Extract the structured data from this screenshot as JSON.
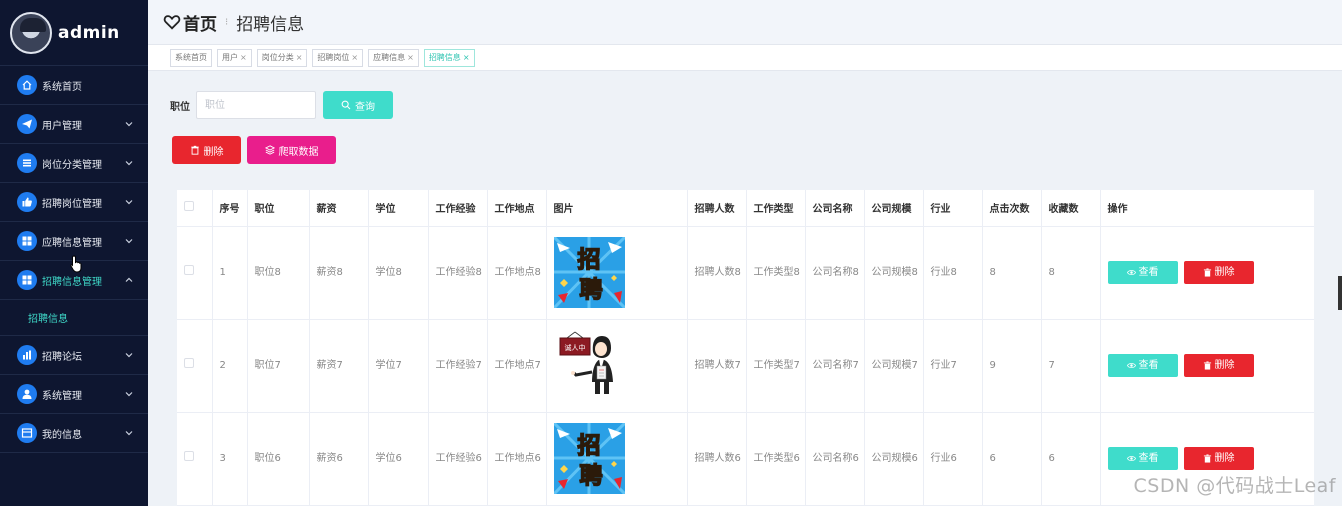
{
  "sidebar": {
    "username": "admin",
    "items": [
      {
        "label": "系统首页",
        "icon": "home-icon",
        "expandable": false
      },
      {
        "label": "用户管理",
        "icon": "paper-plane-icon",
        "expandable": true
      },
      {
        "label": "岗位分类管理",
        "icon": "list-icon",
        "expandable": true
      },
      {
        "label": "招聘岗位管理",
        "icon": "thumb-up-icon",
        "expandable": true
      },
      {
        "label": "应聘信息管理",
        "icon": "grid-icon",
        "expandable": true
      },
      {
        "label": "招聘信息管理",
        "icon": "grid-icon",
        "expandable": true,
        "active": true
      },
      {
        "label": "招聘论坛",
        "icon": "bar-chart-icon",
        "expandable": true
      },
      {
        "label": "系统管理",
        "icon": "user-icon",
        "expandable": true
      },
      {
        "label": "我的信息",
        "icon": "card-icon",
        "expandable": true
      }
    ],
    "submenu_label": "招聘信息"
  },
  "header": {
    "home": "首页",
    "current": "招聘信息"
  },
  "tags": [
    {
      "label": "系统首页",
      "closable": false
    },
    {
      "label": "用户",
      "closable": true
    },
    {
      "label": "岗位分类",
      "closable": true
    },
    {
      "label": "招聘岗位",
      "closable": true
    },
    {
      "label": "应聘信息",
      "closable": true
    },
    {
      "label": "招聘信息",
      "closable": true,
      "active": true
    }
  ],
  "search": {
    "label": "职位",
    "placeholder": "职位",
    "query_button": "查询"
  },
  "actions": {
    "delete_button": "删除",
    "crawl_button": "爬取数据"
  },
  "table": {
    "headers": [
      "序号",
      "职位",
      "薪资",
      "学位",
      "工作经验",
      "工作地点",
      "图片",
      "招聘人数",
      "工作类型",
      "公司名称",
      "公司规模",
      "行业",
      "点击次数",
      "收藏数",
      "操作"
    ],
    "rows": [
      {
        "idx": "1",
        "position": "职位8",
        "salary": "薪资8",
        "degree": "学位8",
        "exp": "工作经验8",
        "loc": "工作地点8",
        "pic": "zhaopin-poster",
        "count": "招聘人数8",
        "type": "工作类型8",
        "company": "公司名称8",
        "scale": "公司规模8",
        "industry": "行业8",
        "clicks": "8",
        "favs": "8"
      },
      {
        "idx": "2",
        "position": "职位7",
        "salary": "薪资7",
        "degree": "学位7",
        "exp": "工作经验7",
        "loc": "工作地点7",
        "pic": "recruiter-figure",
        "count": "招聘人数7",
        "type": "工作类型7",
        "company": "公司名称7",
        "scale": "公司规模7",
        "industry": "行业7",
        "clicks": "9",
        "favs": "7"
      },
      {
        "idx": "3",
        "position": "职位6",
        "salary": "薪资6",
        "degree": "学位6",
        "exp": "工作经验6",
        "loc": "工作地点6",
        "pic": "zhaopin-poster",
        "count": "招聘人数6",
        "type": "工作类型6",
        "company": "公司名称6",
        "scale": "公司规模6",
        "industry": "行业6",
        "clicks": "6",
        "favs": "6"
      }
    ],
    "view_label": "查看",
    "delete_label": "删除"
  },
  "poster_text": [
    "招",
    "聘"
  ],
  "sign_text": "诚人中",
  "watermark": "CSDN @代码战士Leaf",
  "colors": {
    "sidebar_bg": "#0e1630",
    "accent_teal": "#3fdccb",
    "danger_red": "#e8262e",
    "crawl_pink": "#e91e8c",
    "menu_icon_blue": "#1f7cf0"
  }
}
